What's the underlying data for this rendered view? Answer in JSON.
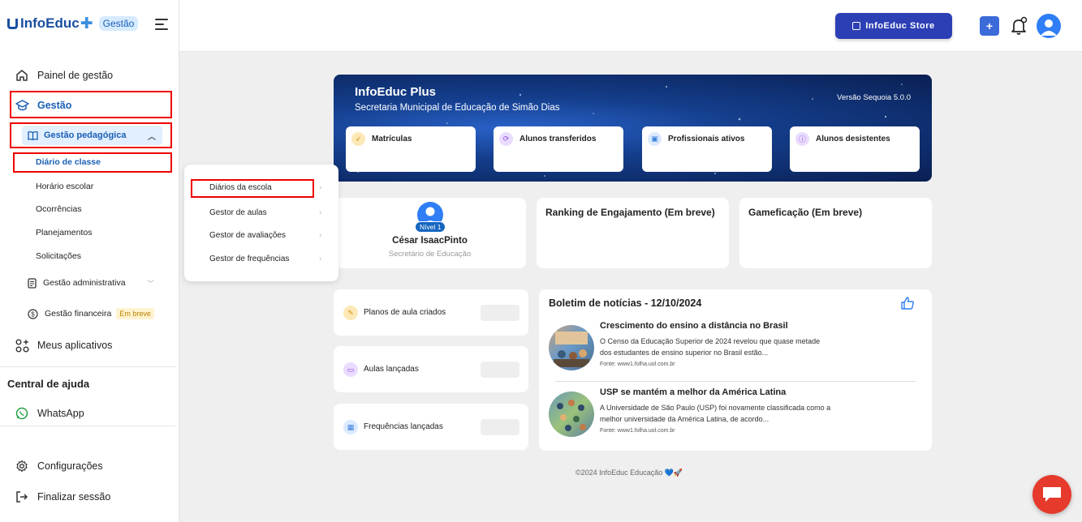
{
  "brand": {
    "name": "InfoEduc",
    "badge": "Gestão"
  },
  "sidebar": {
    "painel": "Painel de gestão",
    "gestao": "Gestão",
    "gestao_pedagogica": "Gestão pedagógica",
    "sub_items": [
      "Diário de classe",
      "Horário escolar",
      "Ocorrências",
      "Planejamentos",
      "Solicitações"
    ],
    "gestao_administrativa": "Gestão administrativa",
    "gestao_financeira": "Gestão financeira",
    "em_breve": "Em breve",
    "meus_aplicativos": "Meus aplicativos",
    "central_ajuda": "Central de ajuda",
    "whatsapp": "WhatsApp",
    "configuracoes": "Configurações",
    "finalizar": "Finalizar sessão"
  },
  "popover": {
    "items": [
      "Diários da escola",
      "Gestor de aulas",
      "Gestor de avaliações",
      "Gestor de frequências"
    ]
  },
  "topbar": {
    "store_label": "InfoEduc Store",
    "plus_label": "+"
  },
  "banner": {
    "title": "InfoEduc Plus",
    "subtitle": "Secretaria Municipal de Educação de Simão Dias",
    "version": "Versão Sequoia 5.0.0",
    "stats": [
      "Matrículas",
      "Alunos transferidos",
      "Profissionais ativos",
      "Alunos desistentes"
    ]
  },
  "user": {
    "level": "Nível 1",
    "name": "César IsaacPinto",
    "role": "Secretário de Educação"
  },
  "ranking": {
    "title": "Ranking de Engajamento (Em breve)"
  },
  "gamificacao": {
    "title": "Gameficação (Em breve)"
  },
  "mini_cards": [
    "Planos de aula criados",
    "Aulas lançadas",
    "Frequências lançadas"
  ],
  "news": {
    "title": "Boletim de notícias - 12/10/2024",
    "items": [
      {
        "headline": "Crescimento do ensino a distância no Brasil",
        "line1": "O Censo da Educação Superior de 2024 revelou que quase metade",
        "line2": "dos estudantes de ensino superior no Brasil estão...",
        "source": "Fonte: www1.folha.uol.com.br"
      },
      {
        "headline": "USP se mantém a melhor da América Latina",
        "line1": "A Universidade de São Paulo (USP) foi novamente classificada como a",
        "line2": "melhor universidade da América Latina, de acordo...",
        "source": "Fonte: www1.folha.uol.com.br"
      }
    ]
  },
  "footer": {
    "text": "©2024 InfoEduc Educação 💙🚀"
  },
  "colors": {
    "primary": "#1a4fa0",
    "store_button": "#2d3fb5",
    "highlight_box": "#e00000",
    "chat_button": "#e53a2c"
  }
}
